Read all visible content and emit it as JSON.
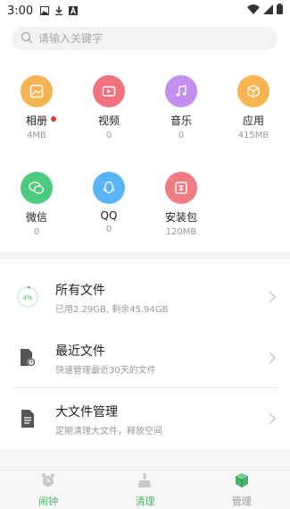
{
  "status": {
    "time": "3:00"
  },
  "search": {
    "placeholder": "请输入关键字"
  },
  "categories": [
    {
      "label": "相册",
      "sub": "4MB",
      "color": "#f6b352",
      "icon": "photo-icon",
      "badge": true
    },
    {
      "label": "视频",
      "sub": "0",
      "color": "#f2717e",
      "icon": "video-icon"
    },
    {
      "label": "音乐",
      "sub": "0",
      "color": "#c08ff0",
      "icon": "music-icon"
    },
    {
      "label": "应用",
      "sub": "415MB",
      "color": "#f7b450",
      "icon": "app-box-icon"
    },
    {
      "label": "微信",
      "sub": "0",
      "color": "#4ccb7f",
      "icon": "wechat-icon"
    },
    {
      "label": "QQ",
      "sub": "0",
      "color": "#5ab4f5",
      "icon": "qq-icon"
    },
    {
      "label": "安装包",
      "sub": "120MB",
      "color": "#f07b83",
      "icon": "package-icon"
    }
  ],
  "list": [
    {
      "title": "所有文件",
      "sub": "已用2.29GB, 剩余45.94GB",
      "icon": "storage-ring-icon",
      "percent": "4%"
    },
    {
      "title": "最近文件",
      "sub": "快速管理最近30天的文件",
      "icon": "recent-file-icon"
    },
    {
      "title": "大文件管理",
      "sub": "定期清理大文件，释放空间",
      "icon": "large-file-icon"
    }
  ],
  "tabs": [
    {
      "label": "闹钟",
      "color": "#4ab36a",
      "icon": "alarm-icon"
    },
    {
      "label": "清理",
      "color": "#4ab36a",
      "icon": "clean-icon"
    },
    {
      "label": "管理",
      "color": "#999999",
      "icon": "manage-box-icon"
    }
  ]
}
